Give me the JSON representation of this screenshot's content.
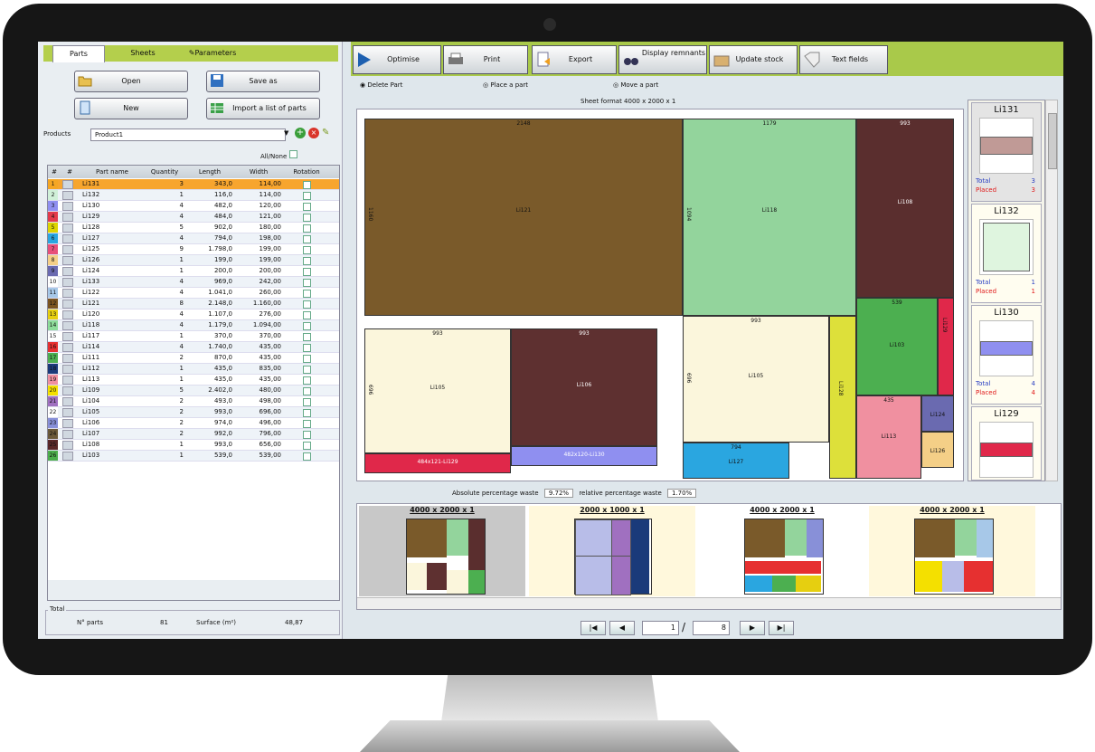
{
  "tabs": [
    "Parts",
    "Sheets",
    "Parameters"
  ],
  "left_buttons": {
    "open": "Open",
    "save_as": "Save as",
    "new": "New",
    "import": "Import a list of parts"
  },
  "products_label": "Products",
  "product_selected": "Product1",
  "all_none": "All/None",
  "table_headers": [
    "#",
    "#",
    "Part name",
    "Quantity",
    "Length",
    "Width",
    "Rotation"
  ],
  "parts": [
    {
      "n": "1",
      "name": "Li131",
      "qty": "3",
      "len": "343,0",
      "wid": "114,00",
      "color": "#f5a623"
    },
    {
      "n": "2",
      "name": "Li132",
      "qty": "1",
      "len": "116,0",
      "wid": "114,00",
      "color": "#d0f0d8"
    },
    {
      "n": "3",
      "name": "Li130",
      "qty": "4",
      "len": "482,0",
      "wid": "120,00",
      "color": "#8f8ff0"
    },
    {
      "n": "4",
      "name": "Li129",
      "qty": "4",
      "len": "484,0",
      "wid": "121,00",
      "color": "#e33a4a"
    },
    {
      "n": "5",
      "name": "Li128",
      "qty": "5",
      "len": "902,0",
      "wid": "180,00",
      "color": "#ddd400"
    },
    {
      "n": "6",
      "name": "Li127",
      "qty": "4",
      "len": "794,0",
      "wid": "198,00",
      "color": "#2aa6e0"
    },
    {
      "n": "7",
      "name": "Li125",
      "qty": "9",
      "len": "1.798,0",
      "wid": "199,00",
      "color": "#e8507a"
    },
    {
      "n": "8",
      "name": "Li126",
      "qty": "1",
      "len": "199,0",
      "wid": "199,00",
      "color": "#f4cf87"
    },
    {
      "n": "9",
      "name": "Li124",
      "qty": "1",
      "len": "200,0",
      "wid": "200,00",
      "color": "#6a6ab0"
    },
    {
      "n": "10",
      "name": "Li133",
      "qty": "4",
      "len": "969,0",
      "wid": "242,00",
      "color": "#ffffff"
    },
    {
      "n": "11",
      "name": "Li122",
      "qty": "4",
      "len": "1.041,0",
      "wid": "260,00",
      "color": "#a7c8e8"
    },
    {
      "n": "12",
      "name": "Li121",
      "qty": "8",
      "len": "2.148,0",
      "wid": "1.160,00",
      "color": "#7a5420"
    },
    {
      "n": "13",
      "name": "Li120",
      "qty": "4",
      "len": "1.107,0",
      "wid": "276,00",
      "color": "#e6cf10"
    },
    {
      "n": "14",
      "name": "Li118",
      "qty": "4",
      "len": "1.179,0",
      "wid": "1.094,00",
      "color": "#8ddc9a"
    },
    {
      "n": "15",
      "name": "Li117",
      "qty": "1",
      "len": "370,0",
      "wid": "370,00",
      "color": "#ffffff"
    },
    {
      "n": "16",
      "name": "Li114",
      "qty": "4",
      "len": "1.740,0",
      "wid": "435,00",
      "color": "#e63030"
    },
    {
      "n": "17",
      "name": "Li111",
      "qty": "2",
      "len": "870,0",
      "wid": "435,00",
      "color": "#4caf50"
    },
    {
      "n": "18",
      "name": "Li112",
      "qty": "1",
      "len": "435,0",
      "wid": "835,00",
      "color": "#1a3a7a"
    },
    {
      "n": "19",
      "name": "Li113",
      "qty": "1",
      "len": "435,0",
      "wid": "435,00",
      "color": "#f090a0"
    },
    {
      "n": "20",
      "name": "Li109",
      "qty": "5",
      "len": "2.402,0",
      "wid": "480,00",
      "color": "#f4e000"
    },
    {
      "n": "21",
      "name": "Li104",
      "qty": "2",
      "len": "493,0",
      "wid": "498,00",
      "color": "#a070c0"
    },
    {
      "n": "22",
      "name": "Li105",
      "qty": "2",
      "len": "993,0",
      "wid": "696,00",
      "color": "#ffffff"
    },
    {
      "n": "23",
      "name": "Li106",
      "qty": "2",
      "len": "974,0",
      "wid": "496,00",
      "color": "#8890d8"
    },
    {
      "n": "24",
      "name": "Li107",
      "qty": "2",
      "len": "992,0",
      "wid": "796,00",
      "color": "#6b5a3a"
    },
    {
      "n": "25",
      "name": "Li108",
      "qty": "1",
      "len": "993,0",
      "wid": "656,00",
      "color": "#5a2828"
    },
    {
      "n": "26",
      "name": "Li103",
      "qty": "1",
      "len": "539,0",
      "wid": "539,00",
      "color": "#4cae4c"
    }
  ],
  "total": {
    "label": "Total",
    "parts_label": "N° parts",
    "parts_value": "81",
    "surface_label": "Surface (m²)",
    "surface_value": "48,87"
  },
  "toolbar": [
    "Optimise",
    "Print",
    "Export",
    "Display remnants",
    "Update stock",
    "Text fields"
  ],
  "actions": [
    "Delete Part",
    "Place a part",
    "Move a part"
  ],
  "sheet_format": "Sheet format 4000 x 2000 x 1",
  "plan_parts": [
    {
      "name": "Li121",
      "dim_top": "2148",
      "dim_side": "1160",
      "color": "#7a5a2a"
    },
    {
      "name": "Li118",
      "dim_top": "1179",
      "dim_side": "1094",
      "color": "#93d49c"
    },
    {
      "name": "Li108",
      "dim_top": "993",
      "color": "#5a2e2e"
    },
    {
      "name": "Li105",
      "dim_top": "993",
      "dim_side": "696",
      "color": "#fbf6dc"
    },
    {
      "name": "Li105",
      "dim_top": "993",
      "dim_side": "696",
      "color": "#fbf6dc"
    },
    {
      "name": "Li106",
      "dim_top": "993",
      "color": "#5e3030"
    },
    {
      "name": "Li103",
      "dim_top": "539",
      "color": "#4caf50"
    },
    {
      "name": "Li129",
      "color": "#e0284a"
    },
    {
      "name": "Li127",
      "dim_top": "794",
      "color": "#2aa6e0"
    },
    {
      "name": "Li113",
      "dim_top": "435",
      "color": "#f090a0"
    },
    {
      "name": "Li124",
      "color": "#6a6ab0"
    },
    {
      "name": "Li126",
      "color": "#f4cf87"
    },
    {
      "name": "Li128",
      "color": "#dde03a"
    },
    {
      "name": "484x121-Li129",
      "color": "#e0284a"
    },
    {
      "name": "482x120-Li130",
      "color": "#8f8ff0"
    }
  ],
  "side_cards": [
    {
      "name": "Li131",
      "total": "3",
      "placed": "3",
      "color": "#c09a96"
    },
    {
      "name": "Li132",
      "total": "1",
      "placed": "1",
      "color": "#dff5df"
    },
    {
      "name": "Li130",
      "total": "4",
      "placed": "4",
      "color": "#8f8ff0"
    },
    {
      "name": "Li129",
      "color": "#e0284a"
    }
  ],
  "side_labels": {
    "total": "Total",
    "placed": "Placed"
  },
  "waste": {
    "abs_label": "Absolute percentage waste",
    "abs_value": "9.72%",
    "rel_label": "relative percentage waste",
    "rel_value": "1.70%"
  },
  "thumbnails": [
    "4000 x 2000 x 1",
    "2000 x 1000 x 1",
    "4000 x 2000 x 1",
    "4000 x 2000 x 1"
  ],
  "pager": {
    "current": "1",
    "sep": "/",
    "total": "8"
  }
}
